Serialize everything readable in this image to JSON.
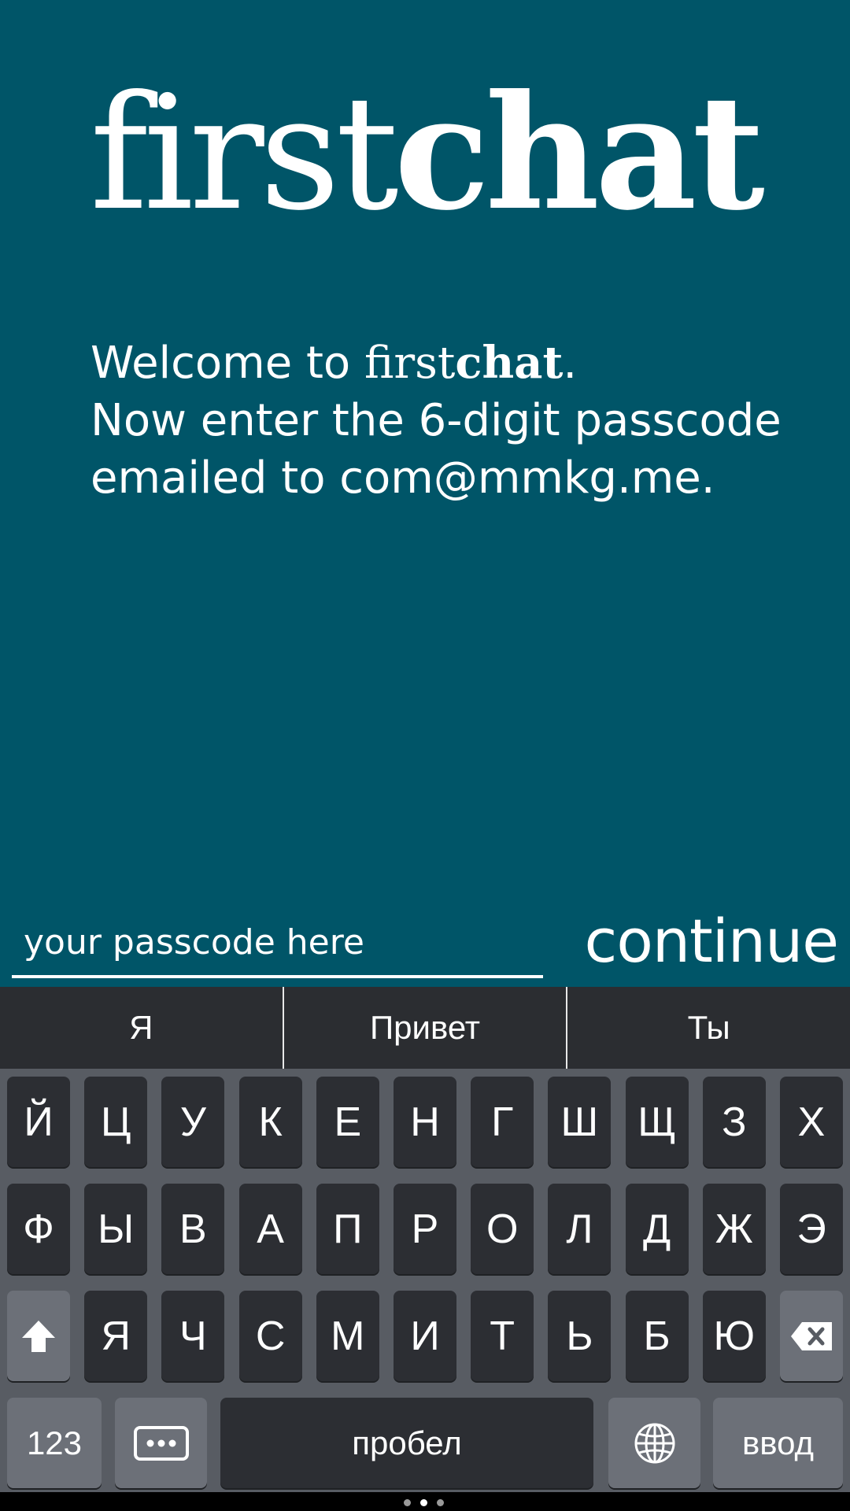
{
  "brand": {
    "first": "first",
    "chat": "chat"
  },
  "welcome": {
    "line1_prefix": "Welcome to ",
    "line1_suffix": ".",
    "line2": "Now enter the 6-digit passcode",
    "line3": "emailed to com@mmkg.me."
  },
  "passcode": {
    "placeholder": "your passcode here",
    "value": ""
  },
  "continue_label": "continue",
  "keyboard": {
    "suggestions": [
      "Я",
      "Привет",
      "Ты"
    ],
    "row1": [
      "Й",
      "Ц",
      "У",
      "К",
      "Е",
      "Н",
      "Г",
      "Ш",
      "Щ",
      "З",
      "Х"
    ],
    "row2": [
      "Ф",
      "Ы",
      "В",
      "А",
      "П",
      "Р",
      "О",
      "Л",
      "Д",
      "Ж",
      "Э"
    ],
    "row3": [
      "Я",
      "Ч",
      "С",
      "М",
      "И",
      "Т",
      "Ь",
      "Б",
      "Ю"
    ],
    "numbers_label": "123",
    "space_label": "пробел",
    "enter_label": "ввод",
    "icons": {
      "shift": "shift-arrow-icon",
      "backspace": "backspace-icon",
      "more": "ellipsis-icon",
      "globe": "globe-icon"
    }
  },
  "colors": {
    "background": "#005568",
    "key": "#2c2e33",
    "keyboard": "#585c63"
  }
}
